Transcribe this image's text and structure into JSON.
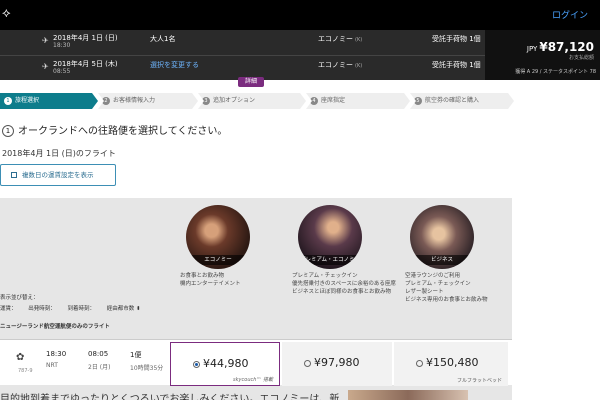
{
  "header": {
    "logo": "⟡",
    "login": "ログイン"
  },
  "summary": {
    "outbound": {
      "date": "2018年4月 1日 (日)",
      "time": "18:30",
      "passengers": "大人1名",
      "cabin": "エコノミー",
      "cabin_code": "(K)",
      "baggage": "受託手荷物 1個"
    },
    "inbound": {
      "date": "2018年4月 5日 (木)",
      "time": "08:55",
      "change": "選択を変更する",
      "cabin": "エコノミー",
      "cabin_code": "(K)",
      "baggage": "受託手荷物 1個"
    },
    "currency": "JPY",
    "total": "¥87,120",
    "total_note": "お支払総額",
    "points": "獲得 A 29 / ステータスポイント 78",
    "details": "詳細"
  },
  "steps": [
    {
      "num": "1",
      "label": "旅程選択"
    },
    {
      "num": "2",
      "label": "お客様情報入力"
    },
    {
      "num": "3",
      "label": "追加オプション"
    },
    {
      "num": "4",
      "label": "座席指定"
    },
    {
      "num": "5",
      "label": "航空券の確認と購入"
    }
  ],
  "main": {
    "step_num": "1",
    "heading": "オークランドへの往路便を選択してください。",
    "flight_date": "2018年4月 1日 (日)のフライト",
    "multi_day_button": "複数日の運賃設定を表示"
  },
  "cabins": [
    {
      "name": "エコノミー",
      "features": [
        "お食事とお飲み物",
        "機内エンターテイメント"
      ]
    },
    {
      "name": "プレミアム・エコノミー",
      "features": [
        "プレミアム・チェックイン",
        "優先搭乗付きのスペースに余裕のある座席",
        "ビジネスとほぼ同様のお食事とお飲み物"
      ]
    },
    {
      "name": "ビジネス",
      "features": [
        "空港ラウンジのご利用",
        "プレミアム・チェックイン",
        "レザー製シート",
        "ビジネス専用のお食事とお飲み物"
      ]
    }
  ],
  "sort": {
    "label": "表示並び替え：",
    "options": [
      "運賃：",
      "出発時刻：",
      "到着時刻：",
      "経由都市数 ⬍"
    ]
  },
  "section_title": "ニュージーランド航空運航便のみのフライト",
  "flight": {
    "airline_icon": "✿",
    "aircraft": "787-9",
    "dep_time": "18:30",
    "dep_airport": "NRT",
    "arr_time": "08:05",
    "arr_day": "2日 (月)",
    "stops": "1便",
    "duration": "10時間35分",
    "fares": [
      {
        "amount": "¥44,980",
        "note": "skycouch™ 搭載",
        "selected": true
      },
      {
        "amount": "¥97,980",
        "note": "",
        "selected": false
      },
      {
        "amount": "¥150,480",
        "note": "フルフラットベッド",
        "selected": false
      }
    ]
  },
  "promo": "目的地到着までゆったりとくつろいでお楽しみください。エコノミーは、新"
}
